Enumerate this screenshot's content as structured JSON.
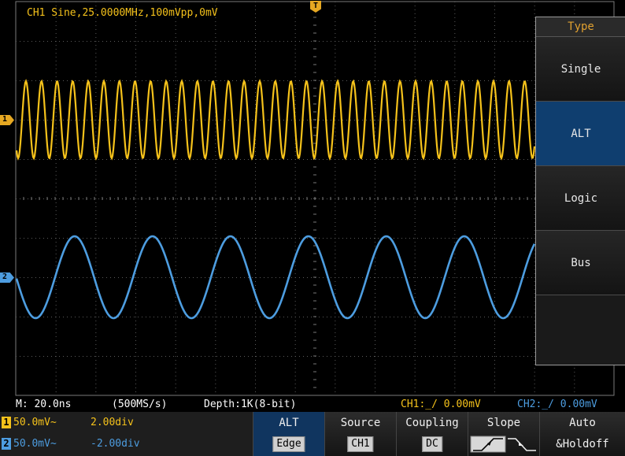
{
  "screen": {
    "title": "CH1 Sine,25.0000MHz,100mVpp,0mV",
    "trigger_marker": "T",
    "ch1_marker": "1",
    "ch2_marker": "2"
  },
  "colors": {
    "ch1": "#f5c21b",
    "ch2": "#4d9de0",
    "grid": "#6a6a6a",
    "menu_selected": "#0f3e6f"
  },
  "menu": {
    "header": "Type",
    "items": [
      {
        "label": "Single",
        "selected": false
      },
      {
        "label": "ALT",
        "selected": true
      },
      {
        "label": "Logic",
        "selected": false
      },
      {
        "label": "Bus",
        "selected": false
      }
    ]
  },
  "status": {
    "timebase": "M: 20.0ns",
    "sample_rate": "(500MS/s)",
    "depth": "Depth:1K(8-bit)",
    "ch1_trigger": "CH1:_/ 0.00mV",
    "ch2_trigger": "CH2:_/ 0.00mV"
  },
  "channels": [
    {
      "num": "1",
      "scale": "50.0mV~",
      "position": "2.00div"
    },
    {
      "num": "2",
      "scale": "50.0mV~",
      "position": "-2.00div"
    }
  ],
  "softkeys": [
    {
      "line1": "ALT",
      "line2": "Edge",
      "selected": true
    },
    {
      "line1": "Source",
      "line2": "CH1"
    },
    {
      "line1": "Coupling",
      "line2": "DC"
    },
    {
      "line1": "Slope",
      "line2": ""
    },
    {
      "line1": "Auto",
      "line2": "&Holdoff"
    }
  ]
}
